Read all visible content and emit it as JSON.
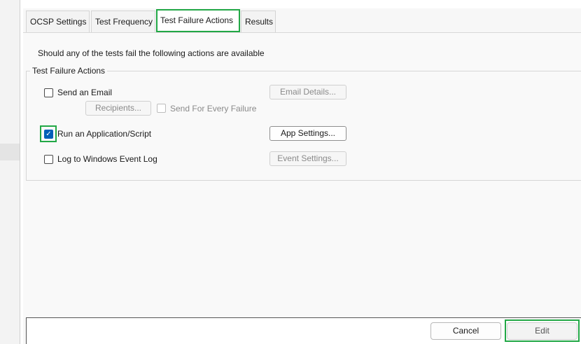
{
  "tabs": [
    {
      "label": "OCSP Settings"
    },
    {
      "label": "Test Frequency"
    },
    {
      "label": "Test Failure Actions"
    },
    {
      "label": "Results"
    }
  ],
  "intro_text": "Should any of the tests fail the following actions are available",
  "group": {
    "title": "Test Failure Actions",
    "send_email": {
      "label": "Send an Email",
      "checked": false,
      "button": "Email Details..."
    },
    "recipients_button": "Recipients...",
    "send_every_failure": {
      "label": "Send For Every Failure",
      "checked": false
    },
    "run_app": {
      "label": "Run an Application/Script",
      "checked": true,
      "button": "App Settings..."
    },
    "log_event": {
      "label": "Log to Windows Event Log",
      "checked": false,
      "button": "Event Settings..."
    }
  },
  "footer": {
    "cancel": "Cancel",
    "edit": "Edit"
  },
  "colors": {
    "highlight": "#22a846",
    "accent": "#005fb8"
  }
}
